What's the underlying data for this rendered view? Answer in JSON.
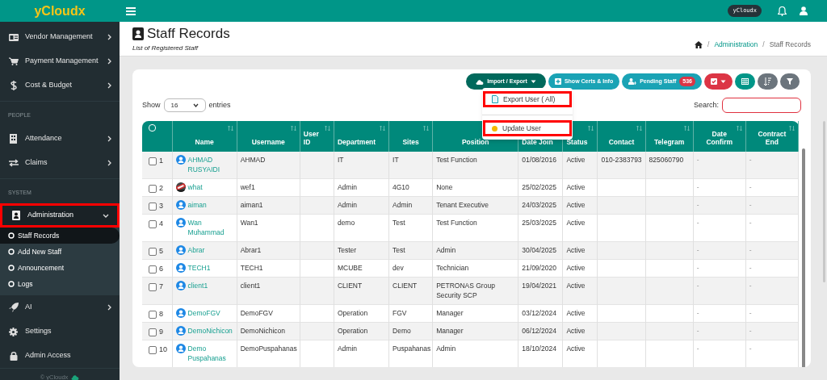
{
  "sidebar": {
    "brand": "yCloudx",
    "items": [
      {
        "kind": "item",
        "label": "Vendor Management",
        "has_arrow": true,
        "selected": false
      },
      {
        "kind": "item",
        "label": "Payment Management",
        "has_arrow": true,
        "selected": false
      },
      {
        "kind": "item",
        "label": "Cost & Budget",
        "has_arrow": true,
        "selected": false
      },
      {
        "kind": "section",
        "label": "PEOPLE"
      },
      {
        "kind": "item",
        "label": "Attendance",
        "has_arrow": true,
        "selected": false
      },
      {
        "kind": "item",
        "label": "Claims",
        "has_arrow": true,
        "selected": false
      },
      {
        "kind": "section",
        "label": "SYSTEM"
      },
      {
        "kind": "item",
        "label": "Administration",
        "has_arrow": true,
        "selected": true,
        "expanded": true,
        "children": [
          {
            "label": "Staff Records",
            "selected": true
          },
          {
            "label": "Add New Staff",
            "selected": false
          },
          {
            "label": "Announcement",
            "selected": false
          },
          {
            "label": "Logs",
            "selected": false
          }
        ]
      },
      {
        "kind": "item",
        "label": "AI",
        "has_arrow": true,
        "selected": false
      },
      {
        "kind": "item",
        "label": "Settings",
        "has_arrow": false,
        "selected": false
      },
      {
        "kind": "item",
        "label": "Admin Access",
        "has_arrow": false,
        "selected": false
      }
    ],
    "footer": "© yCloudx"
  },
  "topbar": {
    "badge": "yCloudx"
  },
  "page": {
    "title": "Staff Records",
    "subtitle": "List of Registered Staff",
    "breadcrumb": [
      {
        "sep": "/",
        "label": "Administration"
      },
      {
        "sep": "/",
        "label": "Staff Records"
      }
    ]
  },
  "toolbar": [
    {
      "kind": "dropdown",
      "label": "Import / Export",
      "color": "#00695c"
    },
    {
      "kind": "button",
      "label": "Show Certs & Info",
      "color": "#1aa3b5"
    },
    {
      "kind": "badge",
      "label": "Pending Staff",
      "count": "536",
      "color": "#1aa3b5"
    },
    {
      "kind": "check",
      "color": "#dc3545"
    },
    {
      "kind": "grid",
      "color": "#009688"
    },
    {
      "kind": "sort",
      "color": "#6c757d"
    },
    {
      "kind": "filter",
      "color": "#6c757d"
    }
  ],
  "menu": [
    {
      "kind": "export",
      "label": "Export User ( All)"
    },
    {
      "kind": "divider"
    },
    {
      "kind": "update",
      "label": "Update User"
    }
  ],
  "length": {
    "before": "Show",
    "value": "16",
    "after": "entries"
  },
  "search": {
    "label": "Search:"
  },
  "table": {
    "select_all_checked": false,
    "columns": [
      "Name",
      "Username",
      "User ID",
      "Department",
      "Sites",
      "Position",
      "Date Join",
      "Status",
      "Contact",
      "Telegram",
      "Date Confirm",
      "Contract End"
    ],
    "rows": [
      {
        "no": "1",
        "checked": false,
        "kind": "default",
        "cells": [
          "AHMAD RUSYAIDI",
          "AHMAD",
          "",
          "IT",
          "IT",
          "Test Function",
          "01/08/2016",
          "Active",
          "010-2383793",
          "825060790",
          "-",
          "-"
        ]
      },
      {
        "no": "2",
        "checked": false,
        "cells": [
          "what",
          "wef1",
          "",
          "Admin",
          "4G10",
          "None",
          "25/02/2025",
          "Active",
          "",
          "",
          "-",
          "-"
        ]
      },
      {
        "no": "3",
        "checked": false,
        "kind": "default",
        "cells": [
          "aiman",
          "aiman1",
          "",
          "Admin",
          "Admin",
          "Tenant Executive",
          "24/03/2025",
          "Active",
          "",
          "",
          "-",
          "-"
        ]
      },
      {
        "no": "4",
        "checked": false,
        "kind": "default",
        "cells": [
          "Wan Muhammad",
          "Wan1",
          "",
          "demo",
          "Test",
          "Test Function",
          "25/03/2025",
          "Active",
          "",
          "",
          "-",
          "-"
        ]
      },
      {
        "no": "5",
        "checked": false,
        "kind": "default",
        "cells": [
          "Abrar",
          "Abrar1",
          "",
          "Tester",
          "Test",
          "Admin",
          "30/04/2025",
          "Active",
          "",
          "",
          "-",
          "-"
        ]
      },
      {
        "no": "6",
        "checked": false,
        "kind": "default",
        "cells": [
          "TECH1",
          "TECH1",
          "",
          "MCUBE",
          "dev",
          "Technician",
          "21/09/2020",
          "Active",
          "",
          "",
          "-",
          "-"
        ]
      },
      {
        "no": "7",
        "checked": false,
        "kind": "default",
        "cells": [
          "client1",
          "client1",
          "",
          "CLIENT",
          "CLIENT",
          "PETRONAS Group Security SCP",
          "19/04/2021",
          "Active",
          "",
          "",
          "-",
          "-"
        ]
      },
      {
        "no": "8",
        "checked": false,
        "kind": "default",
        "cells": [
          "DemoFGV",
          "DemoFGV",
          "",
          "Operation",
          "FGV",
          "Manager",
          "03/12/2024",
          "Active",
          "",
          "",
          "-",
          "-"
        ]
      },
      {
        "no": "9",
        "checked": false,
        "kind": "default",
        "cells": [
          "DemoNichicon",
          "DemoNichicon",
          "",
          "Operation",
          "Demo",
          "Manager",
          "06/12/2024",
          "Active",
          "",
          "",
          "-",
          "-"
        ]
      },
      {
        "no": "10",
        "checked": false,
        "kind": "default",
        "cells": [
          "Demo Puspahanas",
          "DemoPuspahanas",
          "",
          "Admin",
          "Puspahanas",
          "Admin",
          "18/10/2024",
          "Active",
          "",
          "",
          "-",
          "-"
        ]
      }
    ]
  }
}
